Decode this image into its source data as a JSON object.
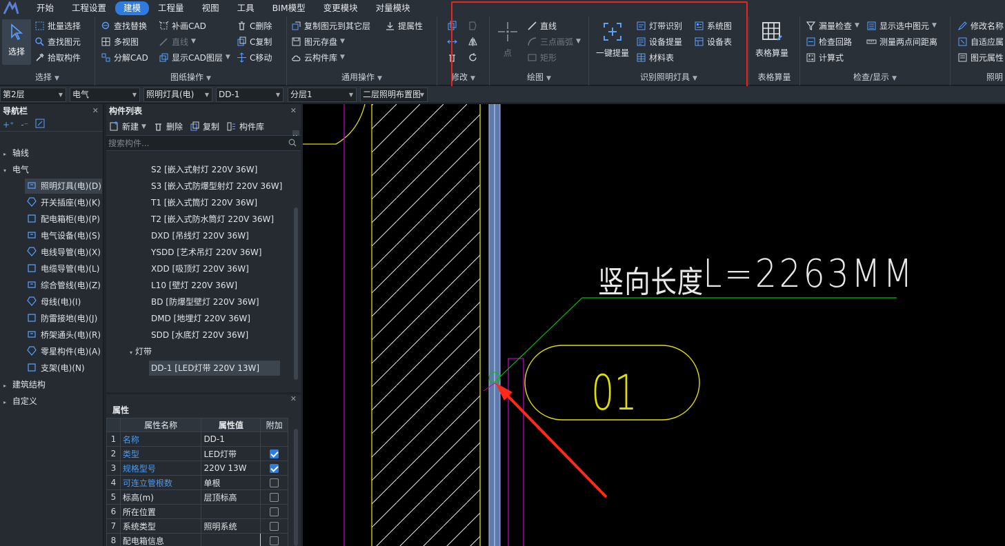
{
  "menu": [
    "开始",
    "工程设置",
    "建模",
    "工程量",
    "视图",
    "工具",
    "BIM模型",
    "变更模块",
    "对量模块"
  ],
  "menu_active": "建模",
  "ribbon": {
    "select": {
      "big": "选择",
      "items": [
        "批量选择",
        "查找图元",
        "拾取构件"
      ],
      "title": "选择"
    },
    "drawing": {
      "items": [
        "查找替换",
        "补画CAD",
        "C删除",
        "多视图",
        "直线",
        "C复制",
        "分解CAD",
        "显示CAD图层",
        "C移动"
      ],
      "title": "图纸操作"
    },
    "general": {
      "items": [
        "复制图元到其它层",
        "提属性",
        "图元存盘",
        "云构件库"
      ],
      "title": "通用操作"
    },
    "modify": {
      "title": "修改"
    },
    "draw": {
      "point": "点",
      "items": [
        "直线",
        "三点画弧",
        "矩形"
      ],
      "title": "绘图"
    },
    "identify": {
      "big": "一键提量",
      "items": [
        "灯带识别",
        "系统图",
        "设备提量",
        "设备表",
        "材料表"
      ],
      "title": "识别照明灯具"
    },
    "table": {
      "big": "表格算量",
      "title": "表格算量"
    },
    "check": {
      "items": [
        "漏量检查",
        "显示选中图元",
        "检查回路",
        "测量两点间距离",
        "计算式"
      ],
      "title": "检查/显示"
    },
    "extra": {
      "items": [
        "修改名称",
        "自适应属",
        "图元属性"
      ],
      "title": "照明"
    }
  },
  "dropdowns": [
    "第2层",
    "电气",
    "照明灯具(电)",
    "DD-1",
    "分层1",
    "二层照明布置图"
  ],
  "nav": {
    "title": "导航栏",
    "items": [
      {
        "label": "轴线",
        "type": "group"
      },
      {
        "label": "电气",
        "type": "group-open"
      },
      {
        "label": "照明灯具(电)(D)",
        "type": "child",
        "selected": true
      },
      {
        "label": "开关插座(电)(K)",
        "type": "child"
      },
      {
        "label": "配电箱柜(电)(P)",
        "type": "child"
      },
      {
        "label": "电气设备(电)(S)",
        "type": "child"
      },
      {
        "label": "电线导管(电)(X)",
        "type": "child"
      },
      {
        "label": "电缆导管(电)(L)",
        "type": "child"
      },
      {
        "label": "综合管线(电)(Z)",
        "type": "child"
      },
      {
        "label": "母线(电)(I)",
        "type": "child"
      },
      {
        "label": "防雷接地(电)(J)",
        "type": "child"
      },
      {
        "label": "桥架通头(电)(R)",
        "type": "child"
      },
      {
        "label": "零星构件(电)(A)",
        "type": "child"
      },
      {
        "label": "支架(电)(N)",
        "type": "child"
      },
      {
        "label": "建筑结构",
        "type": "group"
      },
      {
        "label": "自定义",
        "type": "group"
      }
    ]
  },
  "complist": {
    "title": "构件列表",
    "tools": [
      "新建",
      "删除",
      "复制",
      "构件库"
    ],
    "search_placeholder": "搜索构件...",
    "items": [
      "S2 [嵌入式射灯 220V 36W]",
      "S3 [嵌入式防爆型射灯 220V 36W]",
      "T1 [嵌入式筒灯 220V 36W]",
      "T2 [嵌入式防水筒灯 220V 36W]",
      "DXD [吊线灯 220V 36W]",
      "YSDD [艺术吊灯 220V 36W]",
      "XDD [吸顶灯 220V 36W]",
      "L10 [壁灯 220V 36W]",
      "BD [防爆型壁灯 220V 36W]",
      "DMD [地埋灯 220V 36W]",
      "SDD [水底灯 220V 36W]"
    ],
    "group": "灯带",
    "group_item": "DD-1 [LED灯带 220V 13W]"
  },
  "props": {
    "title": "属性",
    "headers": [
      "属性名称",
      "属性值",
      "附加"
    ],
    "rows": [
      {
        "n": "1",
        "name": "名称",
        "value": "DD-1",
        "blue": true,
        "cb": null
      },
      {
        "n": "2",
        "name": "类型",
        "value": "LED灯带",
        "blue": true,
        "cb": true
      },
      {
        "n": "3",
        "name": "规格型号",
        "value": "220V 13W",
        "blue": true,
        "cb": true
      },
      {
        "n": "4",
        "name": "可连立管根数",
        "value": "单根",
        "blue": true,
        "cb": false
      },
      {
        "n": "5",
        "name": "标高(m)",
        "value": "层顶标高",
        "blue": false,
        "cb": false
      },
      {
        "n": "6",
        "name": "所在位置",
        "value": "",
        "blue": false,
        "cb": false
      },
      {
        "n": "7",
        "name": "系统类型",
        "value": "照明系统",
        "blue": false,
        "cb": false
      },
      {
        "n": "8",
        "name": "配电箱信息",
        "value": "",
        "blue": false,
        "cb": false
      }
    ]
  },
  "cad": {
    "label": "竖向长度",
    "value": "L=2263MM",
    "tag": "01"
  },
  "colors": {
    "accent": "#2f7be0",
    "highlight_box": "#e8261d",
    "cad_yellow": "#e0e000",
    "cad_magenta": "#c000c0",
    "cad_green": "#00c000"
  }
}
